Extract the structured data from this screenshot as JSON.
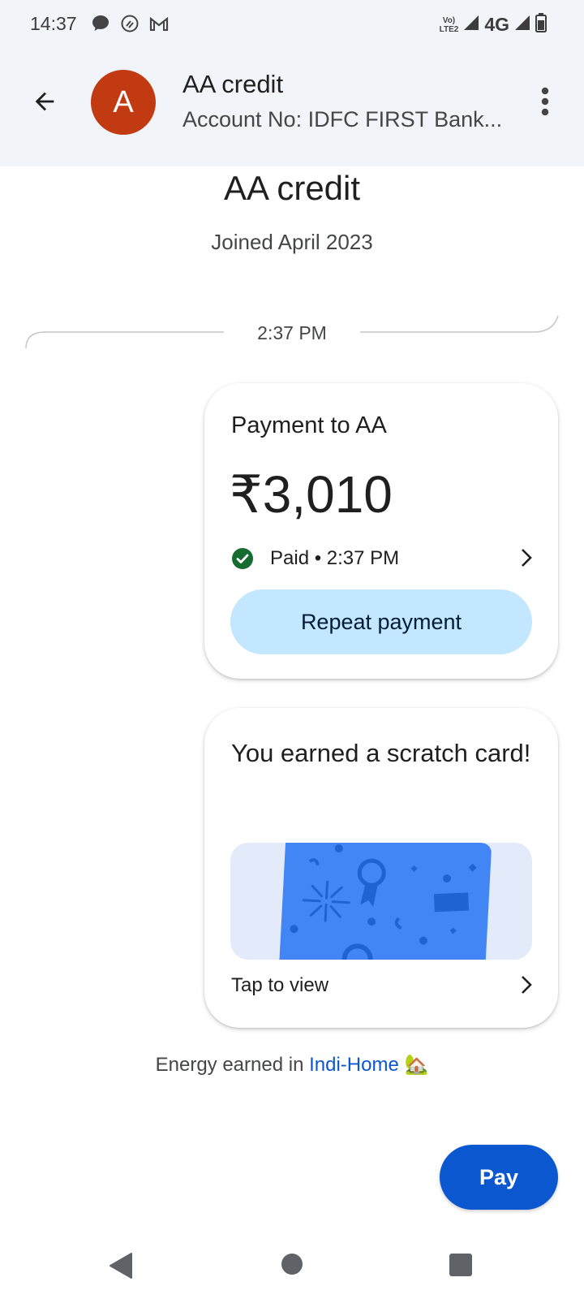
{
  "status_bar": {
    "time": "14:37",
    "network_label": "4G",
    "volte_line1": "Vo)",
    "volte_line2": "LTE2",
    "icons": [
      "message-icon",
      "shazam-like-icon",
      "gmail-icon",
      "signal-icon",
      "signal-icon",
      "battery-icon"
    ]
  },
  "header": {
    "avatar_letter": "A",
    "avatar_color": "#c23a12",
    "contact_name": "AA credit",
    "contact_subtitle": "Account No: IDFC FIRST Bank..."
  },
  "profile": {
    "name": "AA credit",
    "joined": "Joined April 2023"
  },
  "conversation": {
    "divider_time": "2:37 PM",
    "payment_card": {
      "title": "Payment to AA",
      "amount": "₹3,010",
      "status": "Paid • 2:37 PM",
      "status_color": "#146c2e",
      "repeat_label": "Repeat payment"
    },
    "scratch_card": {
      "title": "You earned a scratch card!",
      "tap_label": "Tap to view"
    },
    "energy": {
      "prefix": "Energy earned in ",
      "link": "Indi-Home",
      "emoji": "🏡"
    }
  },
  "actions": {
    "pay_label": "Pay",
    "accent": "#0b57d0"
  }
}
